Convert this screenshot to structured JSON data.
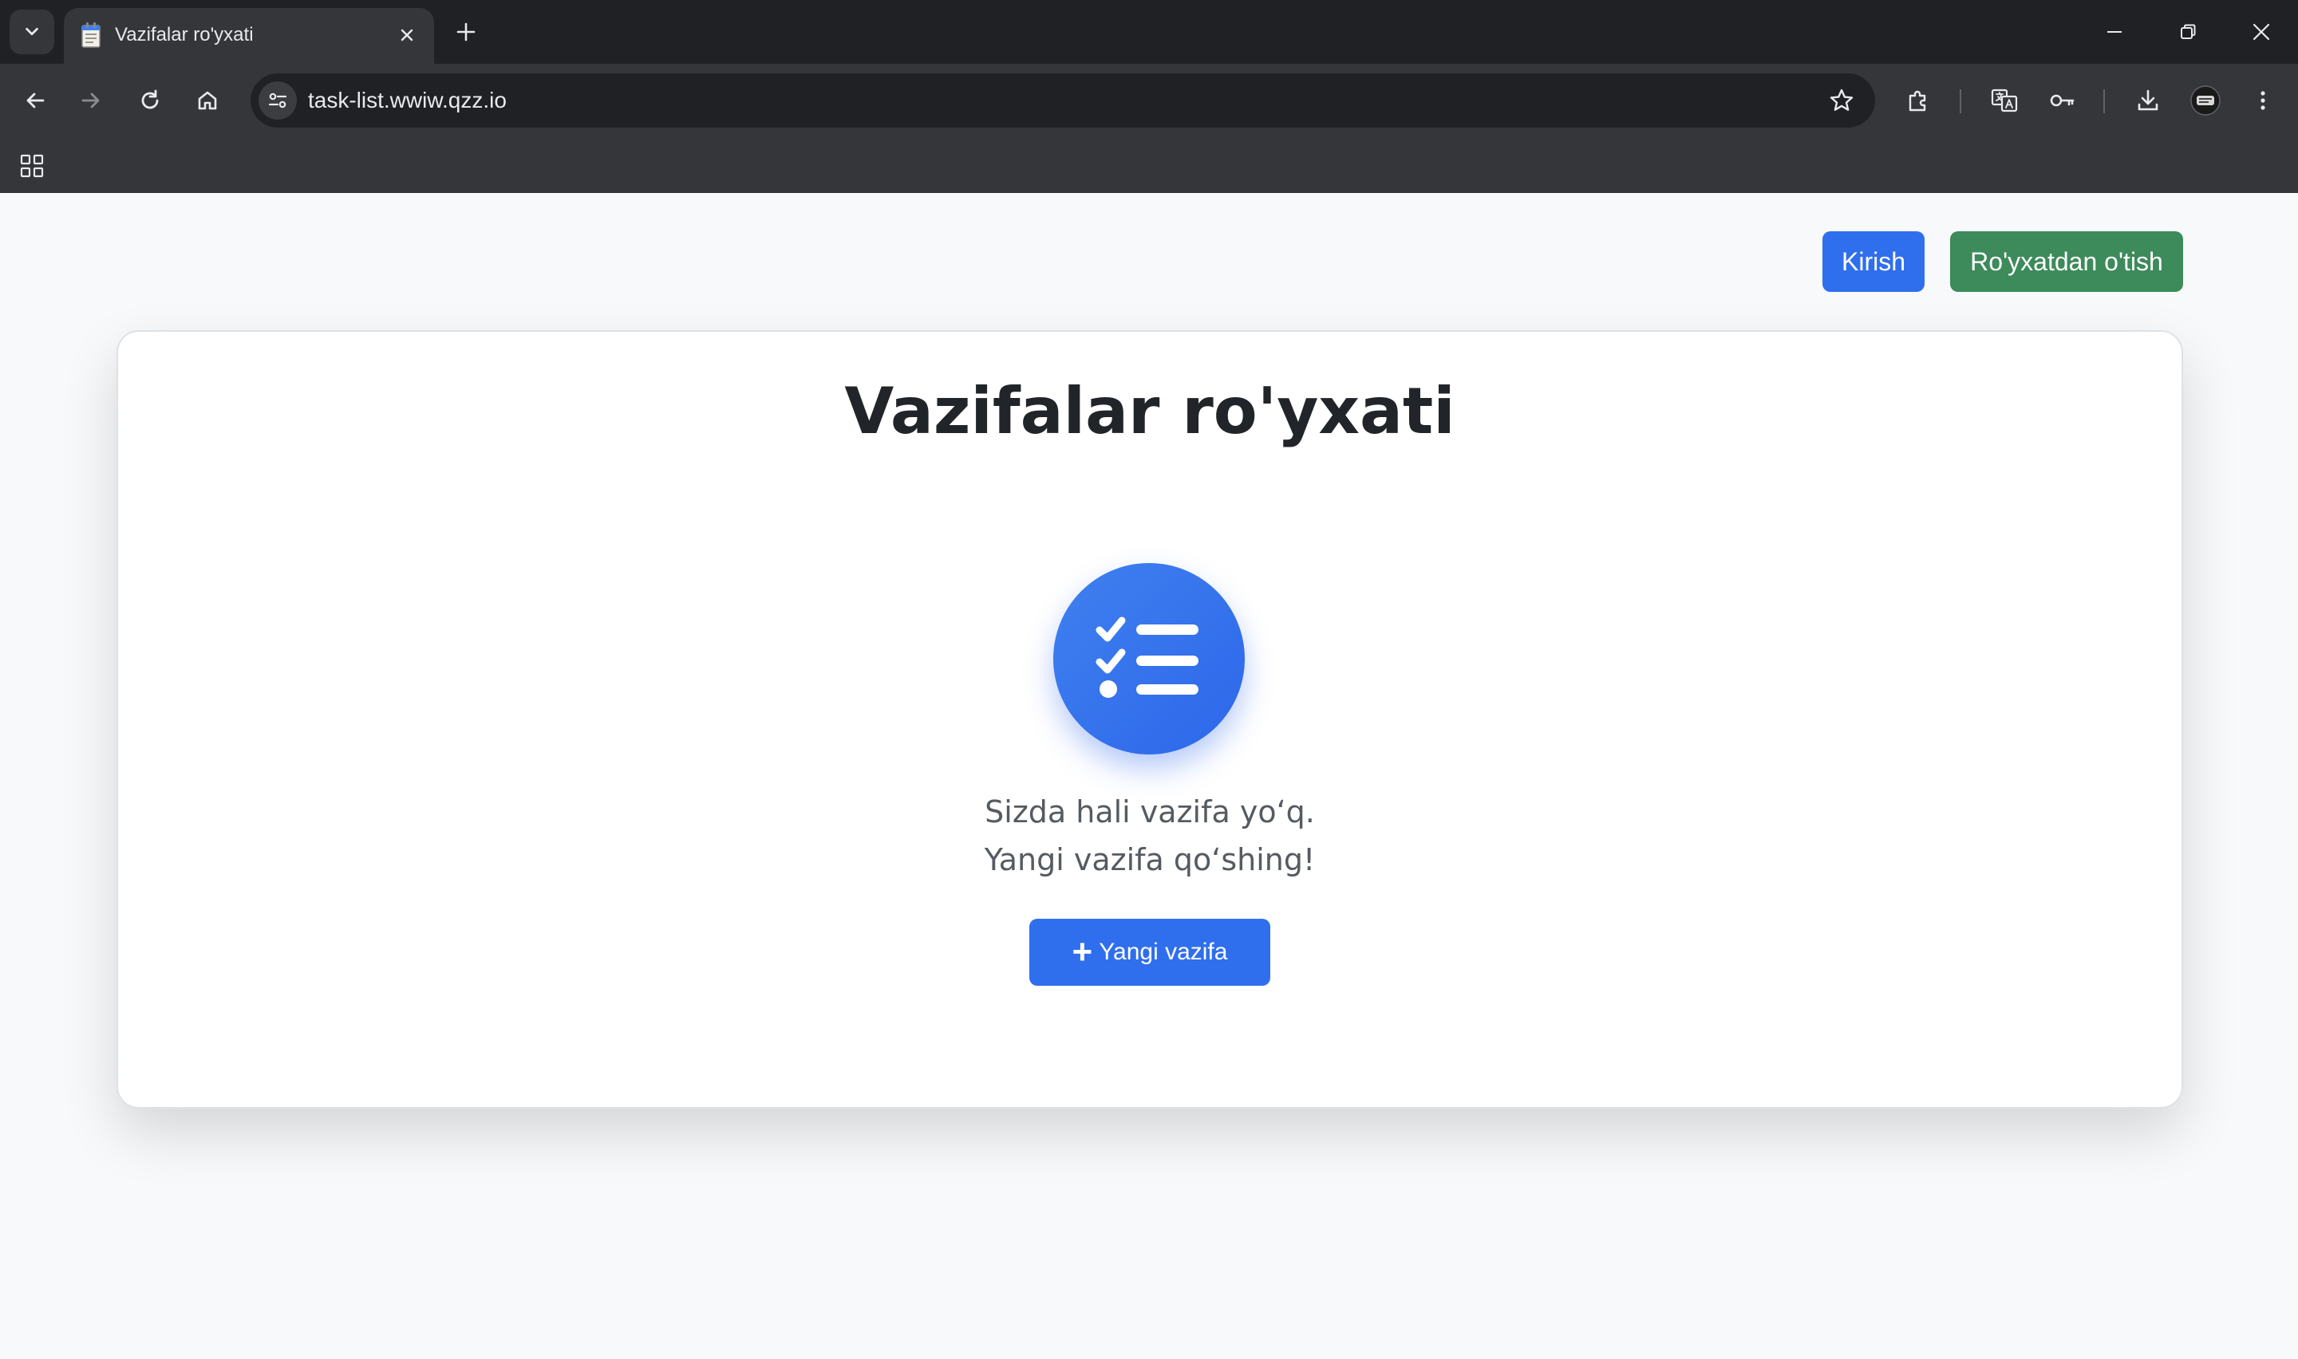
{
  "browser": {
    "tab": {
      "title": "Vazifalar ro'yxati"
    },
    "address_bar": {
      "url": "task-list.wwiw.qzz.io"
    }
  },
  "colors": {
    "primary": "#2f6fed",
    "success": "#3d8a5a",
    "chrome_dark": "#202124",
    "chrome_toolbar": "#35363a"
  },
  "header": {
    "login_label": "Kirish",
    "register_label": "Ro'yxatdan o'tish"
  },
  "main": {
    "title": "Vazifalar ro'yxati",
    "empty_state": {
      "icon": "task-list-icon",
      "line1": "Sizda hali vazifa yo‘q.",
      "line2": "Yangi vazifa qo‘shing!",
      "button_icon": "+",
      "button_label": "Yangi vazifa"
    }
  }
}
